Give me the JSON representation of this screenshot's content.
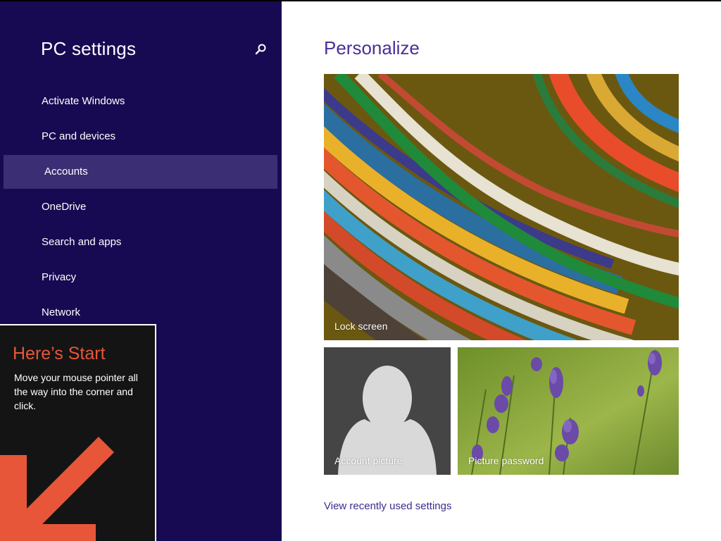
{
  "sidebar": {
    "title": "PC settings",
    "search_icon": "search-icon",
    "items": [
      {
        "label": "Activate Windows",
        "selected": false
      },
      {
        "label": "PC and devices",
        "selected": false
      },
      {
        "label": "Accounts",
        "selected": true
      },
      {
        "label": "OneDrive",
        "selected": false
      },
      {
        "label": "Search and apps",
        "selected": false
      },
      {
        "label": "Privacy",
        "selected": false
      },
      {
        "label": "Network",
        "selected": false
      }
    ]
  },
  "start_tip": {
    "title": "Here’s Start",
    "text": "Move your mouse pointer all the way into the corner and click.",
    "arrow_icon": "arrow-down-left-icon"
  },
  "main": {
    "title": "Personalize",
    "tiles": {
      "lock_screen": "Lock screen",
      "account_picture": "Account picture",
      "picture_password": "Picture password"
    },
    "recent_link": "View recently used settings"
  },
  "colors": {
    "sidebar_bg": "#180a52",
    "selected_bg": "#3c2e74",
    "accent_text": "#4a2f9a",
    "tip_accent": "#e8563a"
  }
}
